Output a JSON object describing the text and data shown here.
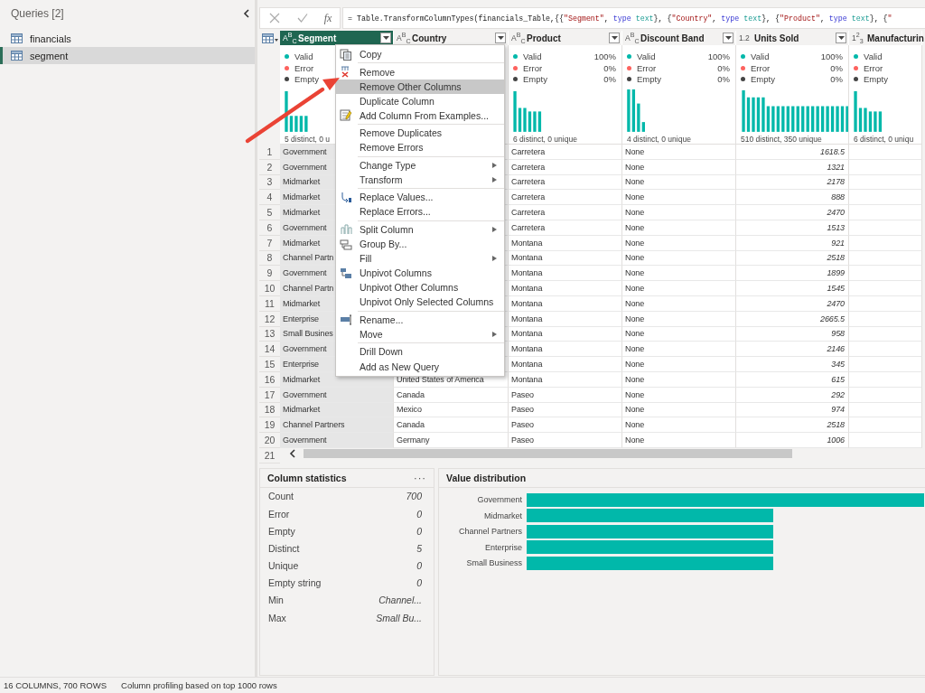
{
  "queries": {
    "title": "Queries [2]",
    "items": [
      {
        "label": "financials",
        "selected": false
      },
      {
        "label": "segment",
        "selected": true
      }
    ]
  },
  "formula_bar": {
    "fx": "fx",
    "formula": [
      {
        "kind": "plain",
        "text": "= Table.TransformColumnTypes(financials_Table,{{"
      },
      {
        "kind": "string",
        "text": "\"Segment\""
      },
      {
        "kind": "plain",
        "text": ", "
      },
      {
        "kind": "keyword",
        "text": "type"
      },
      {
        "kind": "typename",
        "text": " text"
      },
      {
        "kind": "plain",
        "text": "}, {"
      },
      {
        "kind": "string",
        "text": "\"Country\""
      },
      {
        "kind": "plain",
        "text": ", "
      },
      {
        "kind": "keyword",
        "text": "type"
      },
      {
        "kind": "typename",
        "text": " text"
      },
      {
        "kind": "plain",
        "text": "}, {"
      },
      {
        "kind": "string",
        "text": "\"Product\""
      },
      {
        "kind": "plain",
        "text": ", "
      },
      {
        "kind": "keyword",
        "text": "type"
      },
      {
        "kind": "typename",
        "text": " text"
      },
      {
        "kind": "plain",
        "text": "}, {"
      },
      {
        "kind": "string",
        "text": "\""
      }
    ]
  },
  "columns": [
    {
      "type": "A$^{B}$$_{C}$",
      "name": "Segment",
      "kind": "text",
      "selected": true,
      "profile": {
        "lines": [
          {
            "kind": "valid",
            "label": "Valid"
          },
          {
            "kind": "error",
            "label": "Error"
          },
          {
            "kind": "empty",
            "label": "Empty"
          }
        ],
        "summary": "5 distinct, 0 u"
      }
    },
    {
      "type": "A$^{B}$$_{C}$",
      "name": "Country",
      "kind": "text",
      "selected": false
    },
    {
      "type": "A$^{B}$$_{C}$",
      "name": "Product",
      "kind": "text",
      "selected": false,
      "profile": {
        "lines": [
          {
            "kind": "valid",
            "label": "Valid",
            "value": "100%"
          },
          {
            "kind": "error",
            "label": "Error",
            "value": "0%"
          },
          {
            "kind": "empty",
            "label": "Empty",
            "value": "0%"
          }
        ],
        "summary": "6 distinct, 0 unique"
      }
    },
    {
      "type": "A$^{B}$$_{C}$",
      "name": "Discount Band",
      "kind": "text",
      "selected": false,
      "profile": {
        "lines": [
          {
            "kind": "valid",
            "label": "Valid",
            "value": "100%"
          },
          {
            "kind": "error",
            "label": "Error",
            "value": "0%"
          },
          {
            "kind": "empty",
            "label": "Empty",
            "value": "0%"
          }
        ],
        "summary": "4 distinct, 0 unique"
      }
    },
    {
      "type": "1.2",
      "name": "Units Sold",
      "kind": "number",
      "selected": false,
      "profile": {
        "lines": [
          {
            "kind": "valid",
            "label": "Valid",
            "value": "100%"
          },
          {
            "kind": "error",
            "label": "Error",
            "value": "0%"
          },
          {
            "kind": "empty",
            "label": "Empty",
            "value": "0%"
          }
        ],
        "summary": "510 distinct, 350 unique"
      }
    },
    {
      "type": "1$^{2}$$_{3}$",
      "name": "Manufacturin",
      "kind": "number",
      "selected": false,
      "profile": {
        "lines": [
          {
            "kind": "valid",
            "label": "Valid"
          },
          {
            "kind": "error",
            "label": "Error"
          },
          {
            "kind": "empty",
            "label": "Empty"
          }
        ],
        "summary": "6 distinct, 0 uniqu"
      }
    }
  ],
  "rows": [
    {
      "number": "1",
      "segment": "Government",
      "product": "Carretera",
      "discount_band": "None",
      "units_sold": "1618.5"
    },
    {
      "number": "2",
      "segment": "Government",
      "product": "Carretera",
      "discount_band": "None",
      "units_sold": "1321"
    },
    {
      "number": "3",
      "segment": "Midmarket",
      "product": "Carretera",
      "discount_band": "None",
      "units_sold": "2178"
    },
    {
      "number": "4",
      "segment": "Midmarket",
      "product": "Carretera",
      "discount_band": "None",
      "units_sold": "888"
    },
    {
      "number": "5",
      "segment": "Midmarket",
      "product": "Carretera",
      "discount_band": "None",
      "units_sold": "2470"
    },
    {
      "number": "6",
      "segment": "Government",
      "product": "Carretera",
      "discount_band": "None",
      "units_sold": "1513"
    },
    {
      "number": "7",
      "segment": "Midmarket",
      "product": "Montana",
      "discount_band": "None",
      "units_sold": "921"
    },
    {
      "number": "8",
      "segment": "Channel Partn",
      "product": "Montana",
      "discount_band": "None",
      "units_sold": "2518"
    },
    {
      "number": "9",
      "segment": "Government",
      "product": "Montana",
      "discount_band": "None",
      "units_sold": "1899"
    },
    {
      "number": "10",
      "segment": "Channel Partn",
      "product": "Montana",
      "discount_band": "None",
      "units_sold": "1545"
    },
    {
      "number": "11",
      "segment": "Midmarket",
      "product": "Montana",
      "discount_band": "None",
      "units_sold": "2470"
    },
    {
      "number": "12",
      "segment": "Enterprise",
      "product": "Montana",
      "discount_band": "None",
      "units_sold": "2665.5"
    },
    {
      "number": "13",
      "segment": "Small Busines",
      "product": "Montana",
      "discount_band": "None",
      "units_sold": "958"
    },
    {
      "number": "14",
      "segment": "Government",
      "product": "Montana",
      "discount_band": "None",
      "units_sold": "2146"
    },
    {
      "number": "15",
      "segment": "Enterprise",
      "product": "Montana",
      "discount_band": "None",
      "units_sold": "345"
    },
    {
      "number": "16",
      "segment": "Midmarket",
      "country": "United States of America",
      "product": "Montana",
      "discount_band": "None",
      "units_sold": "615"
    },
    {
      "number": "17",
      "segment": "Government",
      "country": "Canada",
      "product": "Paseo",
      "discount_band": "None",
      "units_sold": "292"
    },
    {
      "number": "18",
      "segment": "Midmarket",
      "country": "Mexico",
      "product": "Paseo",
      "discount_band": "None",
      "units_sold": "974"
    },
    {
      "number": "19",
      "segment": "Channel Partners",
      "country": "Canada",
      "product": "Paseo",
      "discount_band": "None",
      "units_sold": "2518"
    },
    {
      "number": "20",
      "segment": "Government",
      "country": "Germany",
      "product": "Paseo",
      "discount_band": "None",
      "units_sold": "1006"
    },
    {
      "number": "21"
    }
  ],
  "context_menu": [
    {
      "label": "Copy",
      "selected": false,
      "separator_before": false,
      "submenu": false
    },
    {
      "label": "Remove",
      "selected": false,
      "separator_before": true,
      "submenu": false
    },
    {
      "label": "Remove Other Columns",
      "selected": true,
      "separator_before": false,
      "submenu": false
    },
    {
      "label": "Duplicate Column",
      "selected": false,
      "separator_before": false,
      "submenu": false
    },
    {
      "label": "Add Column From Examples...",
      "selected": false,
      "separator_before": false,
      "submenu": false
    },
    {
      "label": "Remove Duplicates",
      "selected": false,
      "separator_before": true,
      "submenu": false
    },
    {
      "label": "Remove Errors",
      "selected": false,
      "separator_before": false,
      "submenu": false
    },
    {
      "label": "Change Type",
      "selected": false,
      "separator_before": true,
      "submenu": true
    },
    {
      "label": "Transform",
      "selected": false,
      "separator_before": false,
      "submenu": true
    },
    {
      "label": "Replace Values...",
      "selected": false,
      "separator_before": true,
      "submenu": false
    },
    {
      "label": "Replace Errors...",
      "selected": false,
      "separator_before": false,
      "submenu": false
    },
    {
      "label": "Split Column",
      "selected": false,
      "separator_before": true,
      "submenu": true
    },
    {
      "label": "Group By...",
      "selected": false,
      "separator_before": false,
      "submenu": false
    },
    {
      "label": "Fill",
      "selected": false,
      "separator_before": false,
      "submenu": true
    },
    {
      "label": "Unpivot Columns",
      "selected": false,
      "separator_before": false,
      "submenu": false
    },
    {
      "label": "Unpivot Other Columns",
      "selected": false,
      "separator_before": false,
      "submenu": false
    },
    {
      "label": "Unpivot Only Selected Columns",
      "selected": false,
      "separator_before": false,
      "submenu": false
    },
    {
      "label": "Rename...",
      "selected": false,
      "separator_before": true,
      "submenu": false
    },
    {
      "label": "Move",
      "selected": false,
      "separator_before": false,
      "submenu": true
    },
    {
      "label": "Drill Down",
      "selected": false,
      "separator_before": true,
      "submenu": false
    },
    {
      "label": "Add as New Query",
      "selected": false,
      "separator_before": false,
      "submenu": false
    }
  ],
  "column_statistics": {
    "title": "Column statistics",
    "menu": "···",
    "stats": [
      {
        "label": "Count",
        "value": "700"
      },
      {
        "label": "Error",
        "value": "0"
      },
      {
        "label": "Empty",
        "value": "0"
      },
      {
        "label": "Distinct",
        "value": "5"
      },
      {
        "label": "Unique",
        "value": "0"
      },
      {
        "label": "Empty string",
        "value": "0"
      },
      {
        "label": "Min",
        "value": "Channel..."
      },
      {
        "label": "Max",
        "value": "Small Bu..."
      }
    ]
  },
  "value_distribution": {
    "title": "Value distribution",
    "categories": [
      "Government",
      "Midmarket",
      "Channel Partners",
      "Enterprise",
      "Small Business"
    ]
  },
  "status_bar": [
    "16 COLUMNS, 700 ROWS",
    "Column profiling based on top 1000 rows"
  ]
}
